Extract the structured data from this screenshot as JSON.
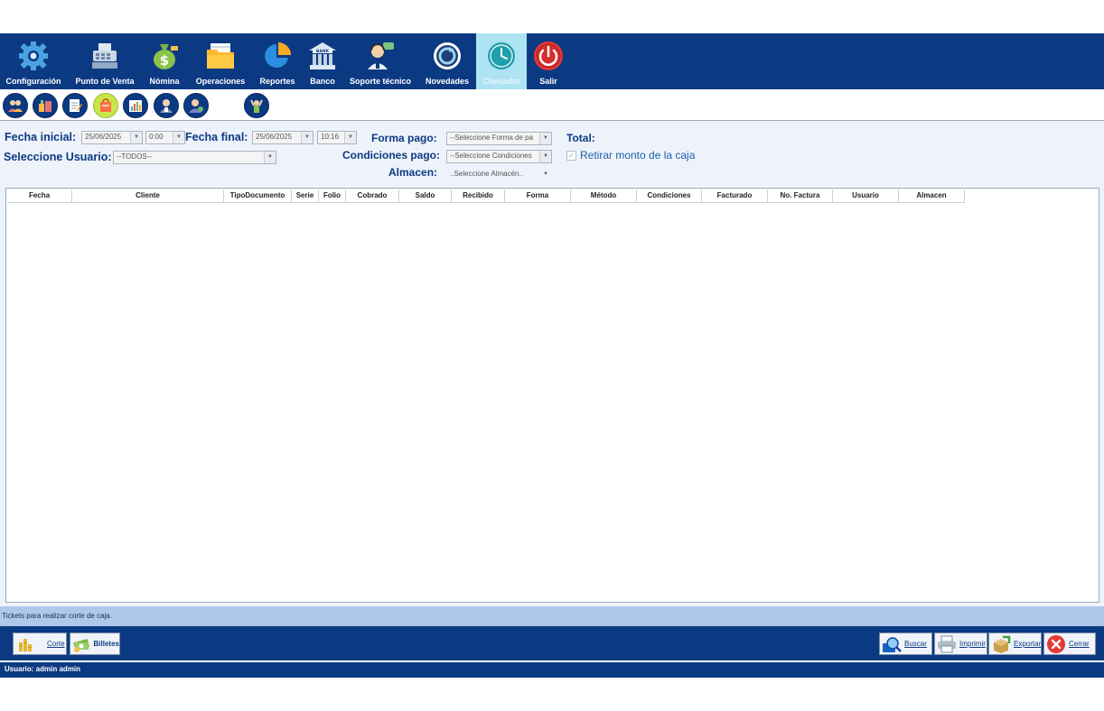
{
  "menu": {
    "items": [
      {
        "label": "Configuración",
        "icon": "gear-icon"
      },
      {
        "label": "Punto de Venta",
        "icon": "cash-register-icon"
      },
      {
        "label": "Nómina",
        "icon": "money-bag-icon"
      },
      {
        "label": "Operaciones",
        "icon": "folder-icon"
      },
      {
        "label": "Reportes",
        "icon": "pie-chart-icon"
      },
      {
        "label": "Banco",
        "icon": "bank-icon"
      },
      {
        "label": "Soporte técnico",
        "icon": "support-agent-icon"
      },
      {
        "label": "Novedades",
        "icon": "refresh-icon"
      },
      {
        "label": "Checador",
        "icon": "clock-icon",
        "active": true
      },
      {
        "label": "Salir",
        "icon": "power-icon"
      }
    ],
    "bank_sign": "BANK"
  },
  "filters": {
    "fecha_inicial_label": "Fecha inicial:",
    "fecha_inicial_date": "25/06/2025",
    "fecha_inicial_time": "0:00",
    "fecha_final_label": "Fecha final:",
    "fecha_final_date": "25/06/2025",
    "fecha_final_time": "10:16",
    "forma_pago_label": "Forma pago:",
    "forma_pago_value": "--Seleccione Forma de pa",
    "total_label": "Total:",
    "usuario_label": "Seleccione Usuario:",
    "usuario_value": "--TODOS--",
    "condiciones_label": "Condiciones pago:",
    "condiciones_value": "--Seleccione Condiciones",
    "retirar_label": "Retirar monto de la caja",
    "retirar_checked": true,
    "almacen_label": "Almacen:",
    "almacen_value": "..Seleccione Almacén.."
  },
  "grid": {
    "columns": [
      "Fecha",
      "Cliente",
      "TipoDocumento",
      "Serie",
      "Folio",
      "Cobrado",
      "Saldo",
      "Recibido",
      "Forma",
      "Método",
      "Condiciones",
      "Facturado",
      "No. Factura",
      "Usuario",
      "Almacen"
    ],
    "rows": []
  },
  "info_text": "Tickets para realizar corte de caja.",
  "bottom": {
    "corte": "Corte",
    "billetes": "Billetes",
    "buscar": "Buscar",
    "imprimir": "Imprimir",
    "exportar": "Exportar",
    "cerrar": "Cerrar"
  },
  "status": "Usuario: admin admin",
  "colors": {
    "navy": "#0c3a82",
    "active_tab": "#aee3f3",
    "info_bar": "#aec8ec",
    "close_red": "#e53935"
  }
}
